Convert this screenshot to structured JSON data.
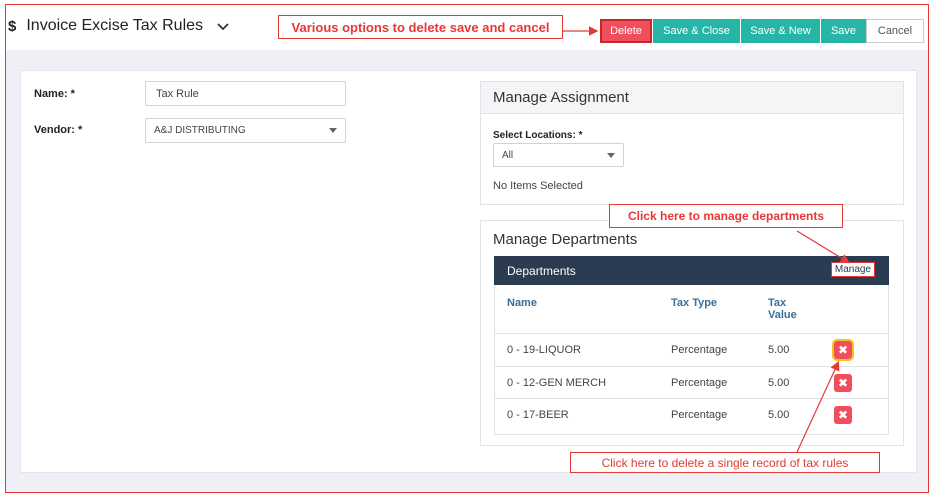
{
  "header": {
    "currency_symbol": "$",
    "title": "Invoice Excise Tax Rules",
    "dropdown_icon": "chevron-down-icon"
  },
  "toolbar": {
    "delete_label": "Delete",
    "save_close_label": "Save & Close",
    "save_new_label": "Save & New",
    "save_label": "Save",
    "cancel_label": "Cancel"
  },
  "form": {
    "name_label": "Name: *",
    "name_value": "Tax Rule",
    "vendor_label": "Vendor: *",
    "vendor_value": "A&J DISTRIBUTING"
  },
  "assignment": {
    "title": "Manage Assignment",
    "locations_label": "Select Locations: *",
    "locations_value": "All",
    "empty_text": "No Items Selected"
  },
  "departments": {
    "title": "Manage Departments",
    "bar_label": "Departments",
    "manage_label": "Manage",
    "columns": {
      "name": "Name",
      "tax_type": "Tax Type",
      "tax_value_1": "Tax",
      "tax_value_2": "Value"
    },
    "rows": [
      {
        "name": "0 - 19-LIQUOR",
        "tax_type": "Percentage",
        "tax_value": "5.00"
      },
      {
        "name": "0 - 12-GEN MERCH",
        "tax_type": "Percentage",
        "tax_value": "5.00"
      },
      {
        "name": "0 - 17-BEER",
        "tax_type": "Percentage",
        "tax_value": "5.00"
      }
    ],
    "delete_icon": "✖"
  },
  "annotations": {
    "top": "Various options to delete save and cancel",
    "manage": "Click here to manage departments",
    "delete": "Click here to delete a single record of tax rules"
  },
  "colors": {
    "accent_red": "#e53935",
    "teal": "#26b5a6",
    "navy": "#2b3b52"
  }
}
